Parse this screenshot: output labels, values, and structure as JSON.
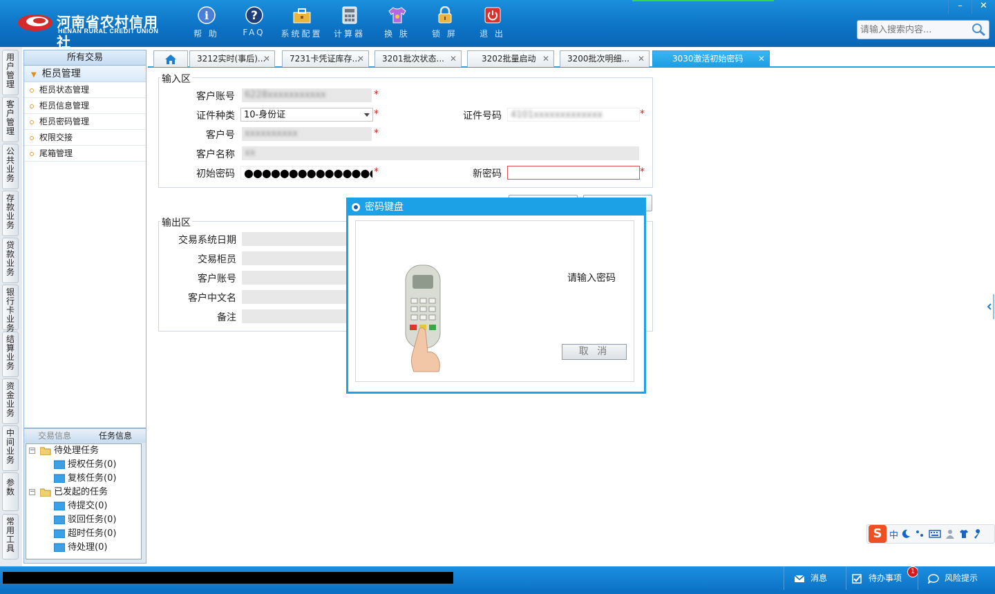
{
  "app": {
    "brand_cn": "河南省农村信用社",
    "brand_en": "HENAN RURAL CREDIT UNION"
  },
  "toolbar": [
    {
      "label": "帮 助",
      "icon": "info-icon"
    },
    {
      "label": "FAQ",
      "icon": "question-icon"
    },
    {
      "label": "系统配置",
      "icon": "toolbox-icon"
    },
    {
      "label": "计算器",
      "icon": "calculator-icon"
    },
    {
      "label": "换 肤",
      "icon": "shirt-icon"
    },
    {
      "label": "锁 屏",
      "icon": "lock-icon"
    },
    {
      "label": "退 出",
      "icon": "power-icon"
    }
  ],
  "window_controls": {
    "minimize": "–",
    "close": "✕"
  },
  "search": {
    "placeholder": "请输入搜索内容..."
  },
  "side_tabs": [
    "用户管理",
    "客户管理",
    "公共业务",
    "存款业务",
    "贷款业务",
    "银行卡业务",
    "结算业务",
    "资金业务",
    "中间业务",
    "参数",
    "常用工具"
  ],
  "nav": {
    "title": "所有交易",
    "group": "柜员管理",
    "items": [
      "柜员状态管理",
      "柜员信息管理",
      "柜员密码管理",
      "权限交接",
      "尾箱管理"
    ]
  },
  "task_panel": {
    "tabs": [
      "交易信息",
      "任务信息"
    ],
    "tree": [
      {
        "label": "待处理任务",
        "level": 0
      },
      {
        "label": "授权任务(0)",
        "level": 1
      },
      {
        "label": "复核任务(0)",
        "level": 1
      },
      {
        "label": "已发起的任务",
        "level": 0
      },
      {
        "label": "待提交(0)",
        "level": 1
      },
      {
        "label": "驳回任务(0)",
        "level": 1
      },
      {
        "label": "超时任务(0)",
        "level": 1
      },
      {
        "label": "待处理(0)",
        "level": 1
      }
    ]
  },
  "doc_tabs": [
    {
      "label": "3212实时(事后)..."
    },
    {
      "label": "7231卡凭证库存..."
    },
    {
      "label": "3201批次状态..."
    },
    {
      "label": "3202批量启动"
    },
    {
      "label": "3200批次明细..."
    },
    {
      "label": "3030激活初始密码",
      "active": true
    }
  ],
  "input_section": {
    "title": "输入区",
    "labels": {
      "account": "客户账号",
      "id_type": "证件种类",
      "id_number": "证件号码",
      "customer_no": "客户号",
      "customer_name": "客户名称",
      "initial_password": "初始密码",
      "new_password": "新密码"
    },
    "values": {
      "id_type": "10-身份证",
      "initial_password_mask": "●●●●●●●●●●●●●●●●"
    }
  },
  "output_section": {
    "title": "输出区",
    "labels": [
      "交易系统日期",
      "交易柜员",
      "客户账号",
      "客户中文名",
      "备注"
    ]
  },
  "dialog": {
    "title": "密码键盘",
    "prompt": "请输入密码",
    "cancel": "取 消"
  },
  "ime": {
    "logo": "S",
    "mode": "中"
  },
  "status_bar": {
    "messages": "消息",
    "todo": "待办事项",
    "todo_count": "1",
    "risk": "风险提示"
  },
  "colors": {
    "header": "#0d72c4",
    "accent": "#1ca0e6",
    "required": "#d42020"
  }
}
